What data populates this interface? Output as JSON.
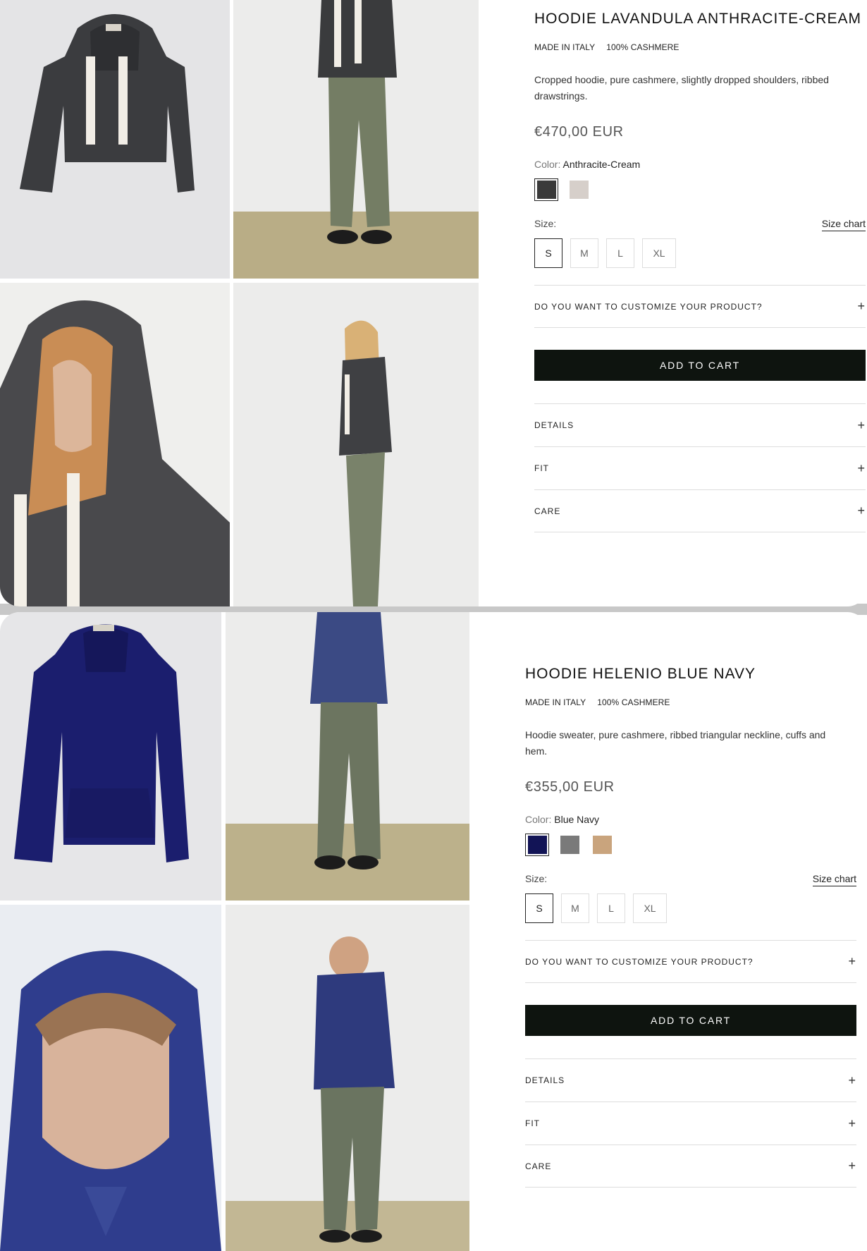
{
  "products": [
    {
      "title": "HOODIE LAVANDULA ANTHRACITE-CREAM",
      "tags": [
        "MADE IN ITALY",
        "100% CASHMERE"
      ],
      "description": "Cropped hoodie, pure cashmere, slightly dropped shoulders, ribbed drawstrings.",
      "price": "€470,00 EUR",
      "color_label": "Color:",
      "color_value": "Anthracite-Cream",
      "swatches": [
        {
          "name": "Anthracite-Cream",
          "color": "#3a3a3a",
          "selected": true
        },
        {
          "name": "Cream",
          "color": "#d6cfca",
          "selected": false
        }
      ],
      "size_label": "Size:",
      "size_chart": "Size chart",
      "sizes": [
        "S",
        "M",
        "L",
        "XL"
      ],
      "selected_size": "S",
      "customize": "DO YOU WANT TO CUSTOMIZE YOUR PRODUCT?",
      "add_to_cart": "ADD TO CART",
      "accordions": [
        "DETAILS",
        "FIT",
        "CARE"
      ],
      "plus": "+"
    },
    {
      "title": "HOODIE HELENIO BLUE NAVY",
      "tags": [
        "MADE IN ITALY",
        "100% CASHMERE"
      ],
      "description": "Hoodie sweater, pure cashmere, ribbed triangular neckline, cuffs and hem.",
      "price": "€355,00 EUR",
      "color_label": "Color:",
      "color_value": "Blue Navy",
      "swatches": [
        {
          "name": "Blue Navy",
          "color": "#121456",
          "selected": true
        },
        {
          "name": "Grey",
          "color": "#7a7a7a",
          "selected": false
        },
        {
          "name": "Camel",
          "color": "#c9a47d",
          "selected": false
        }
      ],
      "size_label": "Size:",
      "size_chart": "Size chart",
      "sizes": [
        "S",
        "M",
        "L",
        "XL"
      ],
      "selected_size": "S",
      "customize": "DO YOU WANT TO CUSTOMIZE YOUR PRODUCT?",
      "add_to_cart": "ADD TO CART",
      "accordions": [
        "DETAILS",
        "FIT",
        "CARE"
      ],
      "plus": "+"
    }
  ]
}
